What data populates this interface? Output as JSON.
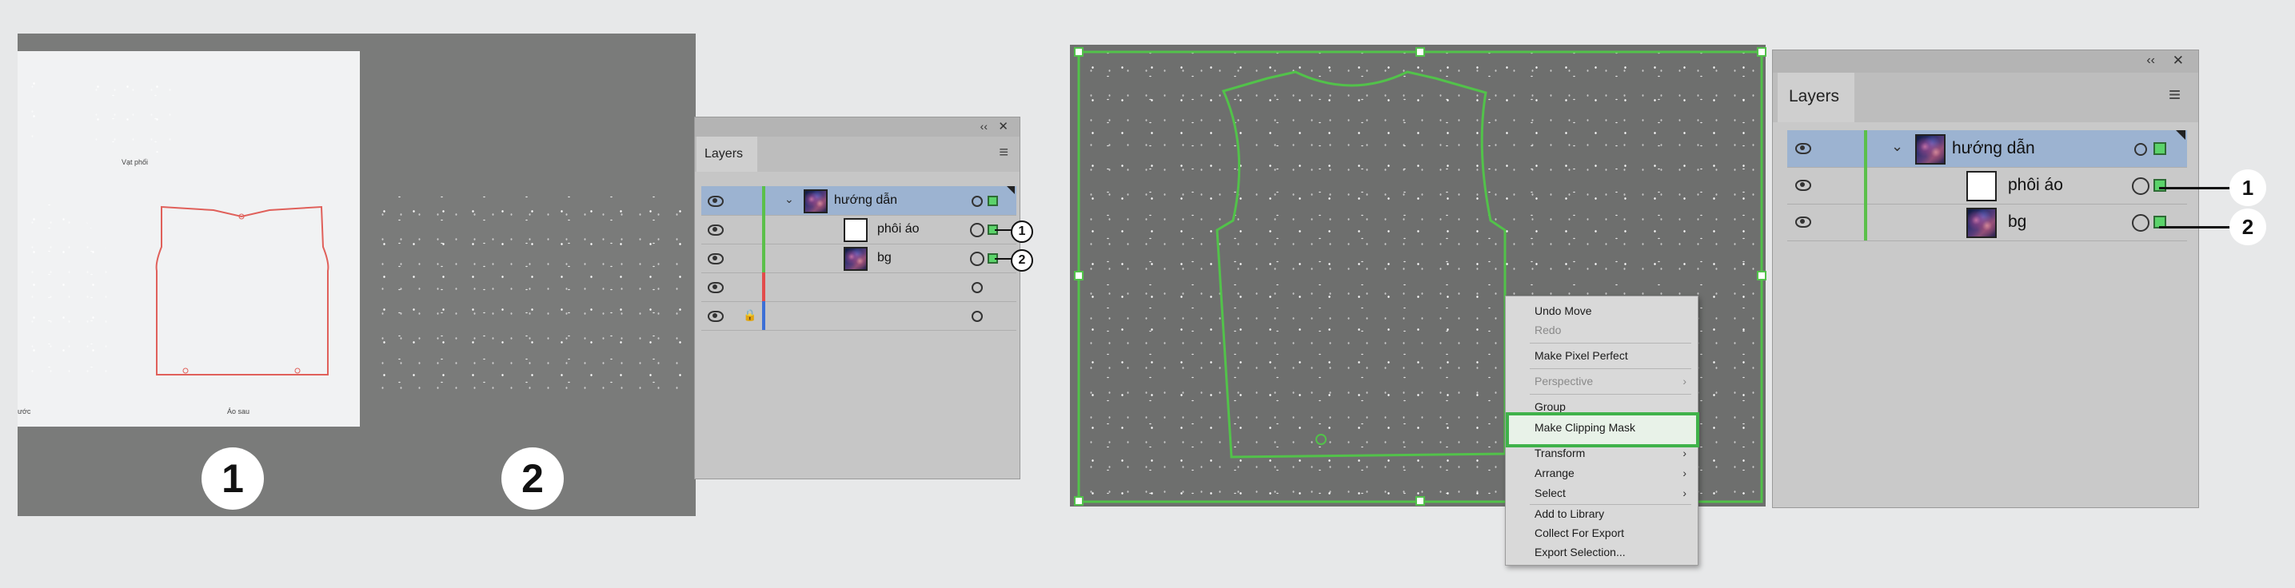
{
  "left_illustration": {
    "pattern_labels": {
      "front_suffix": "ước",
      "sleeve": "Vạt phối",
      "back": "Áo sau"
    },
    "step_numbers": [
      "1",
      "2"
    ]
  },
  "small_layers_panel": {
    "collapse_glyph": "‹‹",
    "close_glyph": "✕",
    "tab_label": "Layers",
    "menu_glyph": "≡",
    "rows": [
      {
        "name": "hướng dẫn",
        "selected": true
      },
      {
        "name": "phôi áo",
        "callout": "1"
      },
      {
        "name": "bg",
        "callout": "2"
      },
      {
        "name": ""
      },
      {
        "name": ""
      }
    ],
    "layer_colors": {
      "top": "#5bc04a",
      "row4": "#e24b4b",
      "row5": "#3c6fd6"
    }
  },
  "large_layers_panel": {
    "collapse_glyph": "‹‹",
    "close_glyph": "✕",
    "tab_label": "Layers",
    "menu_glyph": "≡",
    "rows": [
      {
        "name": "hướng dẫn",
        "selected": true
      },
      {
        "name": "phôi áo",
        "callout": "1"
      },
      {
        "name": "bg",
        "callout": "2"
      }
    ]
  },
  "context_menu": {
    "items": [
      {
        "label": "Undo Move",
        "disabled": false
      },
      {
        "label": "Redo",
        "disabled": true
      },
      {
        "label": "Make Pixel Perfect",
        "disabled": false
      },
      {
        "label": "Perspective",
        "disabled": true,
        "submenu": true
      },
      {
        "label": "Group",
        "disabled": false
      },
      {
        "label": "Make Clipping Mask",
        "disabled": false,
        "highlighted": true
      },
      {
        "label": "Transform",
        "disabled": false,
        "submenu": true
      },
      {
        "label": "Arrange",
        "disabled": false,
        "submenu": true
      },
      {
        "label": "Select",
        "disabled": false,
        "submenu": true
      },
      {
        "label": "Add to Library",
        "disabled": false
      },
      {
        "label": "Collect For Export",
        "disabled": false,
        "submenu": true
      },
      {
        "label": "Export Selection...",
        "disabled": false
      }
    ],
    "highlight_color": "#3fb24a"
  },
  "colors": {
    "selection_outline": "#52c24a",
    "selected_row": "#9cb3d1",
    "panel_bg": "#c6c6c6"
  }
}
